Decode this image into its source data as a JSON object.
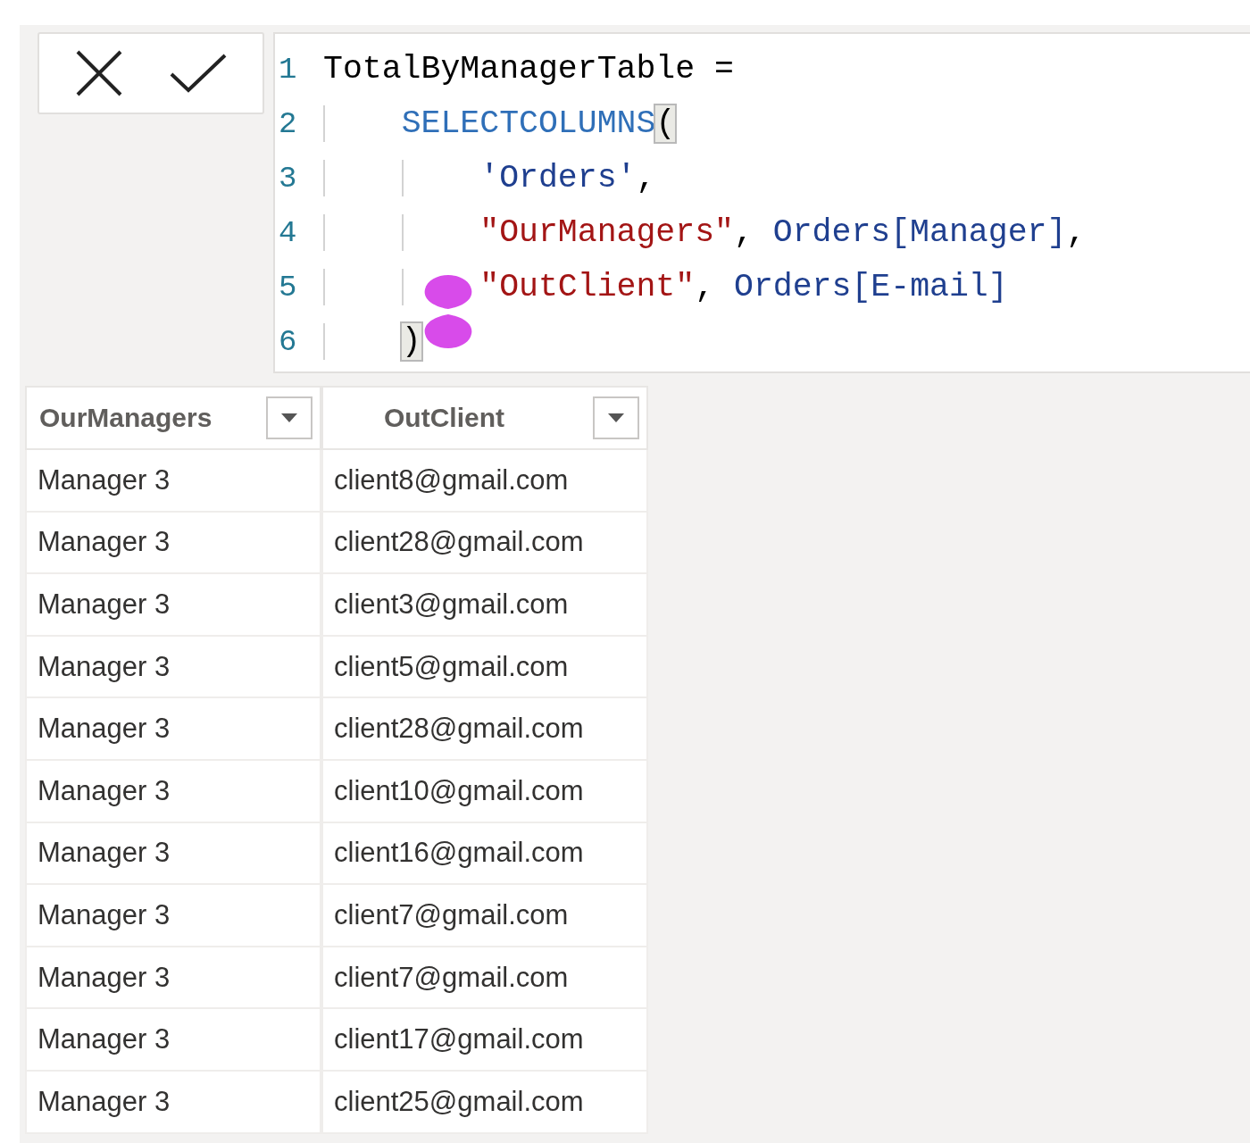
{
  "editor": {
    "lines": [
      {
        "number": "1",
        "tokens": [
          {
            "text": "TotalByManagerTable =",
            "kind": "plain"
          }
        ]
      },
      {
        "number": "2",
        "tokens": [
          {
            "text": "    SELECTCOLUMNS",
            "kind": "function"
          },
          {
            "text": "(",
            "kind": "bracket-match"
          }
        ]
      },
      {
        "number": "3",
        "tokens": [
          {
            "text": "        'Orders'",
            "kind": "table"
          },
          {
            "text": ",",
            "kind": "plain"
          }
        ]
      },
      {
        "number": "4",
        "tokens": [
          {
            "text": "        \"OurManagers\"",
            "kind": "string"
          },
          {
            "text": ", ",
            "kind": "plain"
          },
          {
            "text": "Orders[Manager]",
            "kind": "column"
          },
          {
            "text": ",",
            "kind": "plain"
          }
        ]
      },
      {
        "number": "5",
        "tokens": [
          {
            "text": "        \"OutClient\"",
            "kind": "string"
          },
          {
            "text": ", ",
            "kind": "plain"
          },
          {
            "text": "Orders[E-mail]",
            "kind": "column"
          }
        ]
      },
      {
        "number": "6",
        "tokens": [
          {
            "text": "    )",
            "kind": "bracket-match"
          }
        ]
      }
    ]
  },
  "table": {
    "columns": [
      {
        "label": "OurManagers"
      },
      {
        "label": "OutClient"
      }
    ],
    "rows": [
      [
        "Manager 3",
        "client8@gmail.com"
      ],
      [
        "Manager 3",
        "client28@gmail.com"
      ],
      [
        "Manager 3",
        "client3@gmail.com"
      ],
      [
        "Manager 3",
        "client5@gmail.com"
      ],
      [
        "Manager 3",
        "client28@gmail.com"
      ],
      [
        "Manager 3",
        "client10@gmail.com"
      ],
      [
        "Manager 3",
        "client16@gmail.com"
      ],
      [
        "Manager 3",
        "client7@gmail.com"
      ],
      [
        "Manager 3",
        "client7@gmail.com"
      ],
      [
        "Manager 3",
        "client17@gmail.com"
      ],
      [
        "Manager 3",
        "client25@gmail.com"
      ]
    ]
  }
}
